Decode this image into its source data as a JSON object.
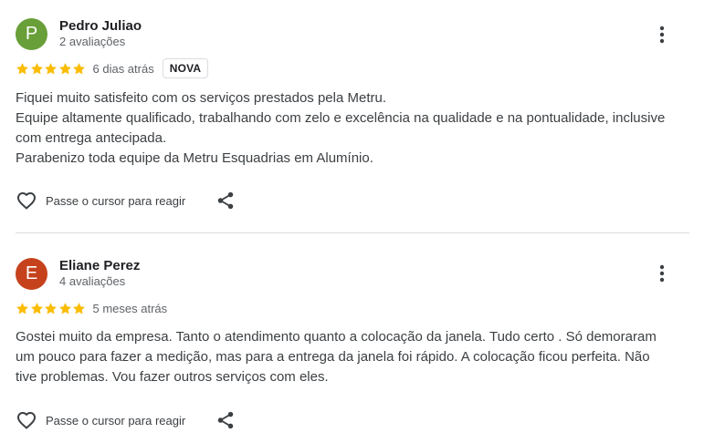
{
  "reviews": [
    {
      "author": "Pedro Juliao",
      "initial": "P",
      "avatar_color": "#689f38",
      "review_count": "2 avaliações",
      "rating": 5,
      "time": "6 dias atrás",
      "badge": "NOVA",
      "text_lines": [
        "Fiquei muito satisfeito com os serviços prestados pela Metru.",
        "Equipe altamente qualificado, trabalhando com zelo e excelência na qualidade e na pontualidade, inclusive com entrega antecipada.",
        "Parabenizo toda equipe da Metru Esquadrias em Alumínio."
      ],
      "like_label": "Passe o cursor para reagir",
      "more_icon": "more-vert-icon",
      "like_icon": "heart-outline-icon",
      "share_icon": "share-icon"
    },
    {
      "author": "Eliane Perez",
      "initial": "E",
      "avatar_color": "#c5421d",
      "review_count": "4 avaliações",
      "rating": 5,
      "time": "5 meses atrás",
      "text_lines": [
        "Gostei muito da empresa. Tanto o atendimento quanto a colocação da janela. Tudo certo . Só demoraram um pouco para fazer a medição, mas para a entrega da janela foi rápido. A colocação ficou perfeita. Não tive problemas. Vou fazer outros serviços com eles."
      ],
      "like_label": "Passe o cursor para reagir",
      "more_icon": "more-vert-icon",
      "like_icon": "heart-outline-icon",
      "share_icon": "share-icon"
    }
  ],
  "colors": {
    "star": "#fbbc04",
    "icon": "#3c4043",
    "divider": "#dadce0"
  }
}
